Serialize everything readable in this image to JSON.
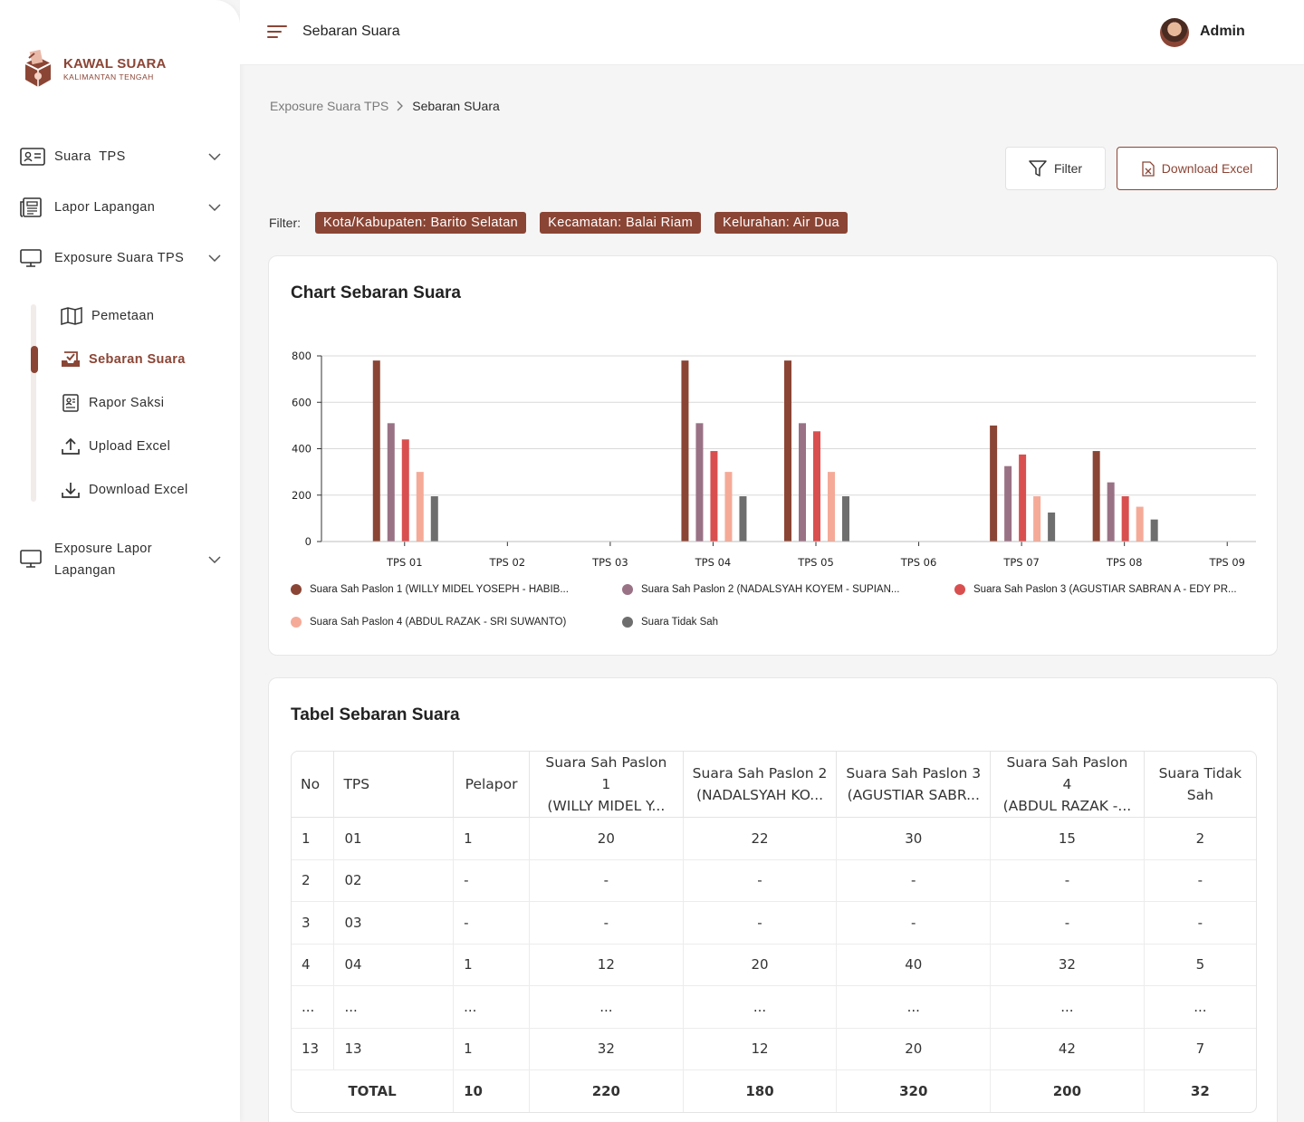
{
  "app": {
    "logo_title": "KAWAL SUARA",
    "logo_subtitle": "KALIMANTAN TENGAH",
    "accent_color": "#8b4535"
  },
  "sidebar": {
    "items": [
      {
        "label": "Suara  TPS",
        "icon": "id-card-icon"
      },
      {
        "label": "Lapor Lapangan",
        "icon": "newspaper-icon"
      },
      {
        "label": "Exposure Suara TPS",
        "icon": "monitor-icon"
      },
      {
        "label": "Exposure Lapor Lapangan",
        "icon": "monitor-icon"
      }
    ],
    "subitems": [
      {
        "label": "Pemetaan",
        "icon": "map-icon"
      },
      {
        "label": "Sebaran Suara",
        "icon": "checkbox-tray-icon",
        "active": true
      },
      {
        "label": "Rapor Saksi",
        "icon": "report-icon"
      },
      {
        "label": "Upload Excel",
        "icon": "upload-icon"
      },
      {
        "label": "Download Excel",
        "icon": "download-icon"
      }
    ],
    "exposure_lapor_line1": "Exposure Lapor",
    "exposure_lapor_line2": "Lapangan"
  },
  "topbar": {
    "title": "Sebaran Suara",
    "user": "Admin"
  },
  "breadcrumb": {
    "parent": "Exposure Suara TPS",
    "current": "Sebaran SUara"
  },
  "actions": {
    "filter_label": "Filter",
    "download_label": "Download Excel"
  },
  "filters": {
    "label": "Filter:",
    "chips": [
      "Kota/Kabupaten: Barito Selatan",
      "Kecamatan: Balai Riam",
      "Kelurahan: Air Dua"
    ]
  },
  "chart_card": {
    "title": "Chart Sebaran Suara"
  },
  "chart_data": {
    "type": "bar",
    "title": "Chart Sebaran Suara",
    "categories": [
      "TPS 01",
      "TPS 02",
      "TPS 03",
      "TPS 04",
      "TPS 05",
      "TPS 06",
      "TPS 07",
      "TPS 08",
      "TPS 09"
    ],
    "ylim": [
      0,
      800
    ],
    "yticks": [
      0,
      200,
      400,
      600,
      800
    ],
    "grid": true,
    "legend_position": "bottom",
    "series": [
      {
        "name": "Suara Sah Paslon 1 (WILLY MIDEL YOSEPH - HABIB...",
        "color": "#8b4535",
        "values": [
          780,
          0,
          0,
          780,
          780,
          0,
          500,
          390,
          0
        ]
      },
      {
        "name": "Suara Sah Paslon 2 (NADALSYAH KOYEM - SUPIAN...",
        "color": "#9a7285",
        "values": [
          510,
          0,
          0,
          510,
          510,
          0,
          325,
          255,
          0
        ]
      },
      {
        "name": "Suara Sah Paslon 3 (AGUSTIAR SABRAN A - EDY PR...",
        "color": "#d94f4f",
        "values": [
          440,
          0,
          0,
          390,
          475,
          0,
          375,
          195,
          0
        ]
      },
      {
        "name": "Suara Sah Paslon 4 (ABDUL RAZAK - SRI SUWANTO)",
        "color": "#f5aa98",
        "values": [
          300,
          0,
          0,
          300,
          300,
          0,
          195,
          150,
          0
        ]
      },
      {
        "name": "Suara Tidak Sah",
        "color": "#6e6e6e",
        "values": [
          195,
          0,
          0,
          195,
          195,
          0,
          125,
          95,
          0
        ]
      }
    ]
  },
  "table_card": {
    "title": "Tabel Sebaran Suara",
    "headers": {
      "no": "No",
      "tps": "TPS",
      "pelapor": "Pelapor",
      "p1a": "Suara Sah Paslon 1",
      "p1b": "(WILLY MIDEL Y...",
      "p2a": "Suara Sah Paslon 2",
      "p2b": "(NADALSYAH KO...",
      "p3a": "Suara Sah Paslon 3",
      "p3b": "(AGUSTIAR SABR...",
      "p4a": "Suara Sah Paslon 4",
      "p4b": "(ABDUL RAZAK -...",
      "tsa": "Suara Tidak",
      "tsb": "Sah"
    },
    "rows": [
      [
        "1",
        "01",
        "1",
        "20",
        "22",
        "30",
        "15",
        "2"
      ],
      [
        "2",
        "02",
        "-",
        "-",
        "-",
        "-",
        "-",
        "-"
      ],
      [
        "3",
        "03",
        "-",
        "-",
        "-",
        "-",
        "-",
        "-"
      ],
      [
        "4",
        "04",
        "1",
        "12",
        "20",
        "40",
        "32",
        "5"
      ],
      [
        "...",
        "...",
        "...",
        "...",
        "...",
        "...",
        "...",
        "..."
      ],
      [
        "13",
        "13",
        "1",
        "32",
        "12",
        "20",
        "42",
        "7"
      ]
    ],
    "total": [
      "TOTAL",
      "10",
      "220",
      "180",
      "320",
      "200",
      "32"
    ]
  }
}
